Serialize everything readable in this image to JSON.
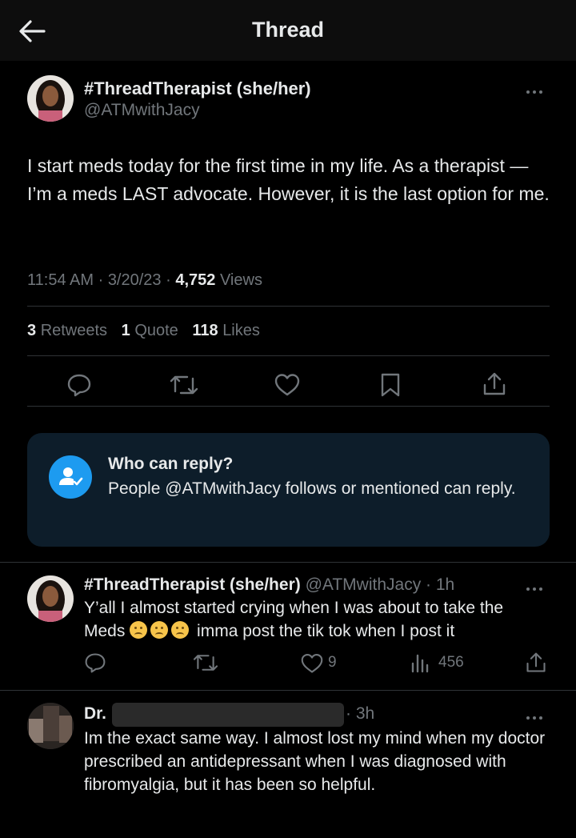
{
  "header": {
    "title": "Thread",
    "back_icon": "arrow-left-icon"
  },
  "post": {
    "display_name": "#ThreadTherapist (she/her)",
    "handle": "@ATMwithJacy",
    "text": "I start meds today for the first time in my life. As a therapist — I’m a meds LAST advocate. However, it is the last option for me.",
    "time": "11:54 AM",
    "date": "3/20/23",
    "views_count": "4,752",
    "views_label": "Views",
    "retweets_count": "3",
    "retweets_label": "Retweets",
    "quotes_count": "1",
    "quotes_label": "Quote",
    "likes_count": "118",
    "likes_label": "Likes"
  },
  "reply_settings": {
    "title": "Who can reply?",
    "description": "People @ATMwithJacy follows or mentioned can reply."
  },
  "replies": [
    {
      "display_name": "#ThreadTherapist (she/her)",
      "handle": "@ATMwithJacy",
      "time": "1h",
      "text_line1": "Y’all I almost started crying when I was about to take the",
      "text_line2_pre": "Meds",
      "text_line2_post": "imma post the tik tok when I post it",
      "likes": "9",
      "views": "456"
    },
    {
      "display_name": "Dr.",
      "time": "3h",
      "text": "Im the exact same way. I almost lost my mind when my doctor prescribed an antidepressant when I was diagnosed with fibromyalgia, but it has been so helpful."
    }
  ],
  "colors": {
    "accent": "#1d9bf0",
    "background": "#000000",
    "muted": "#71767b",
    "card": "#0d1d2a"
  }
}
